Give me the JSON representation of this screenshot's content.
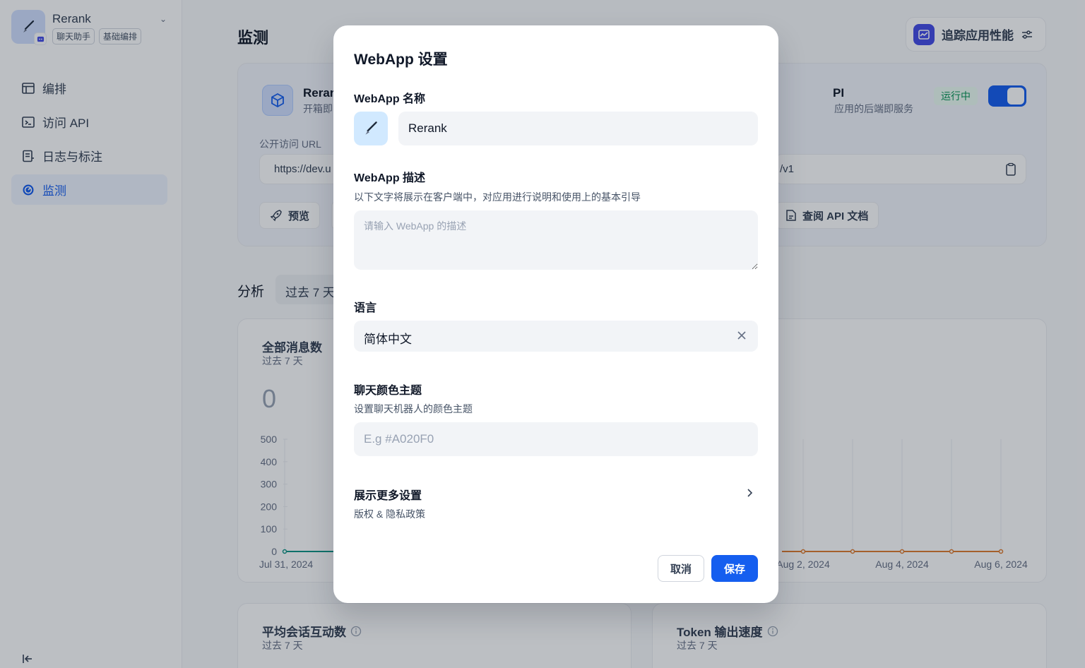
{
  "app": {
    "name": "Rerank",
    "tags": [
      "聊天助手",
      "基础编排"
    ]
  },
  "sidebar": {
    "items": [
      {
        "label": "编排"
      },
      {
        "label": "访问 API"
      },
      {
        "label": "日志与标注"
      },
      {
        "label": "监测"
      }
    ]
  },
  "page": {
    "title": "监测"
  },
  "trace": {
    "label": "追踪应用性能"
  },
  "overview": {
    "webapp_title": "Rerar",
    "webapp_sub": "开箱即",
    "url_label": "公开访问 URL",
    "url_value": "https://dev.u",
    "preview_label": "预览",
    "api_title": "PI",
    "api_sub": "应用的后端即服务",
    "status": "运行中",
    "api_url": "/v1",
    "api_doc_label": "查阅 API 文档"
  },
  "analysis": {
    "label": "分析",
    "period": "过去 7 天"
  },
  "cards": {
    "messages": {
      "title": "全部消息数",
      "sub": "过去 7 天",
      "value": "0"
    },
    "avg_interactions": {
      "title": "平均会话互动数",
      "sub": "过去 7 天"
    },
    "token_speed": {
      "title": "Token 输出速度",
      "sub": "过去 7 天"
    }
  },
  "chart_data": [
    {
      "type": "line",
      "title": "全部消息数",
      "y_ticks": [
        "500",
        "400",
        "300",
        "200",
        "100",
        "0"
      ],
      "ylim": [
        0,
        500
      ],
      "x_visible_labels": [
        "Jul 31, 2024"
      ],
      "series": [
        {
          "values": [
            0,
            0
          ]
        }
      ]
    },
    {
      "type": "line",
      "x_visible_labels": [
        "Aug 2, 2024",
        "Aug 4, 2024",
        "Aug 6, 2024"
      ],
      "series": [
        {
          "values": [
            0,
            0,
            0,
            0,
            0
          ]
        }
      ]
    }
  ],
  "colors": {
    "accent": "#155eef",
    "line_left": "#0e9384",
    "line_right": "#e07a2d"
  },
  "modal": {
    "title": "WebApp 设置",
    "name_label": "WebApp 名称",
    "name_value": "Rerank",
    "desc_label": "WebApp 描述",
    "desc_help": "以下文字将展示在客户端中，对应用进行说明和使用上的基本引导",
    "desc_placeholder": "请输入 WebApp 的描述",
    "lang_label": "语言",
    "lang_value": "简体中文",
    "theme_label": "聊天颜色主题",
    "theme_help": "设置聊天机器人的颜色主题",
    "theme_placeholder": "E.g #A020F0",
    "more_label": "展示更多设置",
    "more_sub": "版权 & 隐私政策",
    "cancel": "取消",
    "save": "保存"
  }
}
